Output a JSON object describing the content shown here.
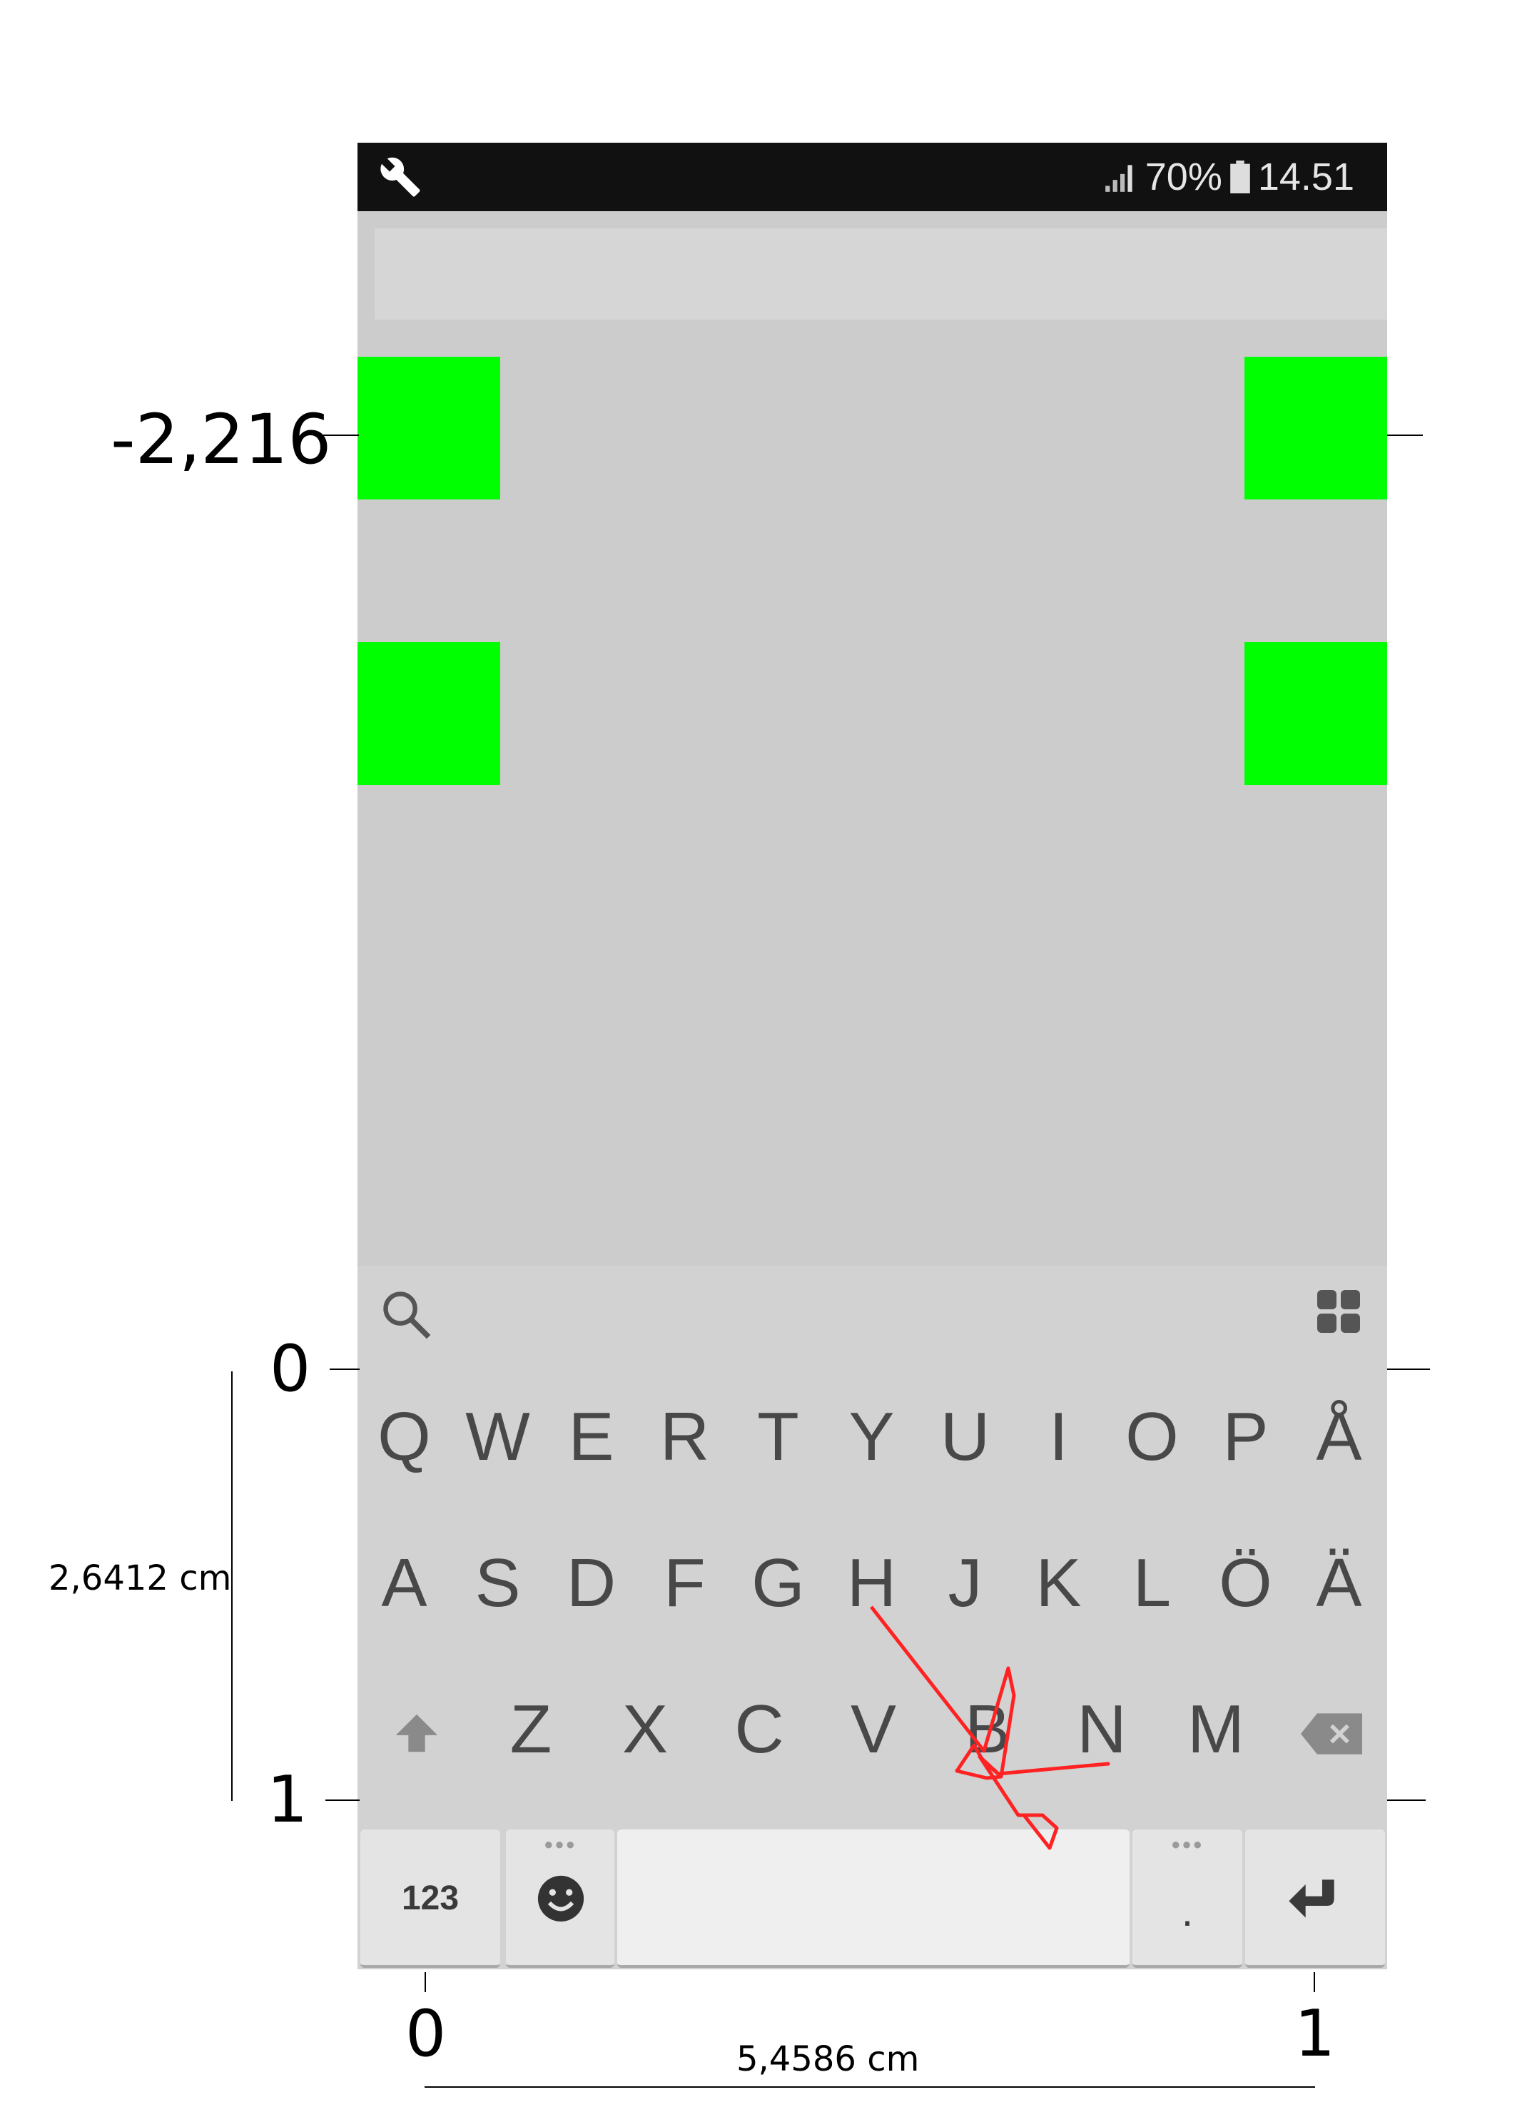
{
  "status_bar": {
    "battery_percent": "70%",
    "time": "14.51",
    "left_icon": "wrench-icon",
    "signal_icon": "signal-icon",
    "battery_icon": "battery-icon"
  },
  "colors": {
    "status_bar_bg": "#111111",
    "screen_bg": "#cccccc",
    "keyboard_bg": "#d2d2d2",
    "target_square": "#00ff00",
    "trace_line": "#ff2222"
  },
  "keyboard": {
    "row1": [
      "Q",
      "W",
      "E",
      "R",
      "T",
      "Y",
      "U",
      "I",
      "O",
      "P",
      "Å"
    ],
    "row2": [
      "A",
      "S",
      "D",
      "F",
      "G",
      "H",
      "J",
      "K",
      "L",
      "Ö",
      "Ä"
    ],
    "row3": [
      "Z",
      "X",
      "C",
      "V",
      "B",
      "N",
      "M"
    ],
    "numbers_key": "123",
    "period_key": ".",
    "toolbar_icons": [
      "search-icon",
      "apps-grid-icon"
    ]
  },
  "annotations": {
    "top_value": "-2,216",
    "y_zero": "0",
    "y_one": "1",
    "height_measure": "2,6412 cm",
    "x_zero": "0",
    "x_one": "1",
    "width_measure": "5,4586 cm"
  }
}
